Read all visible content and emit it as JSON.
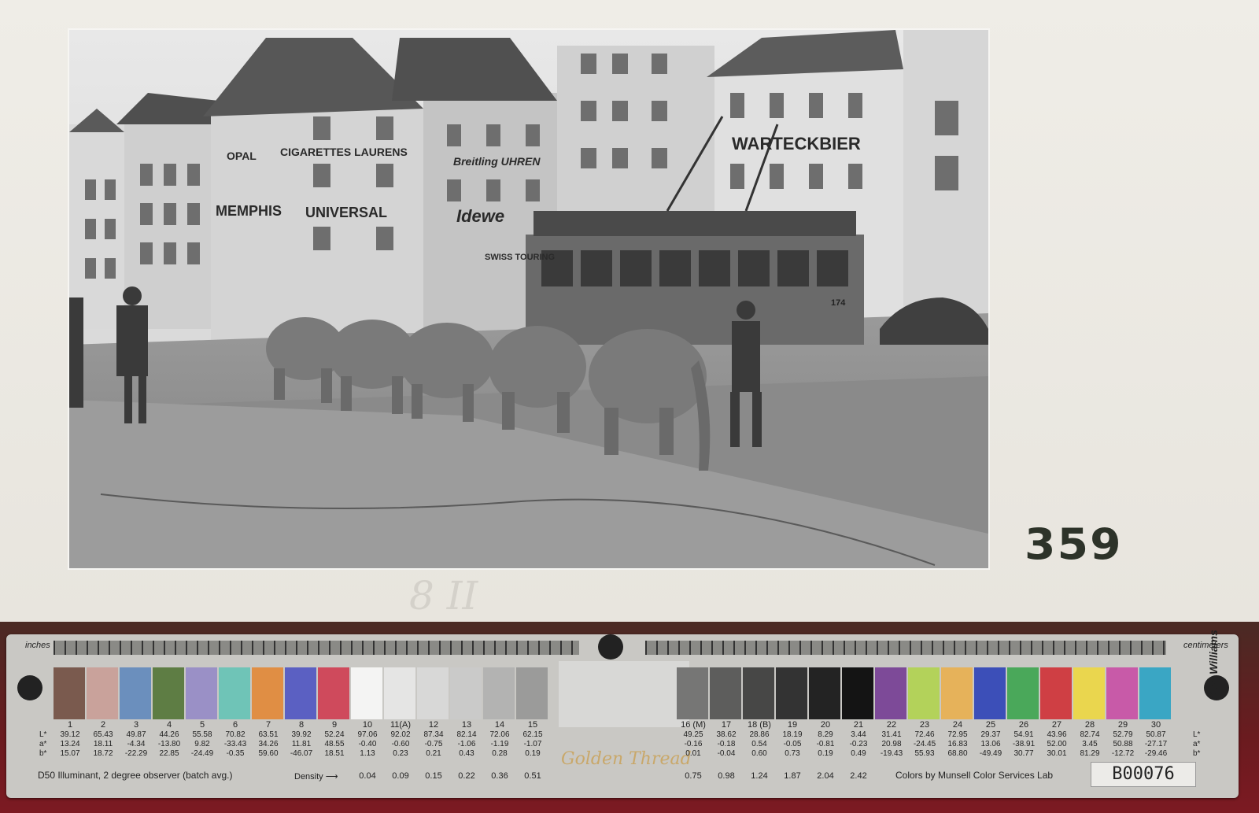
{
  "photo": {
    "description_icon": "street-scene-photo"
  },
  "signs": {
    "laurens": "CIGARETTES LAURENS",
    "opal": "OPAL",
    "memphis": "MEMPHIS",
    "universal": "UNIVERSAL",
    "breitling": "Breitling UHREN",
    "idewe": "Idewe",
    "swiss_touring": "SWISS TOURING",
    "warteckbier": "WARTECKBIER",
    "tram_number": "174"
  },
  "mount": {
    "catalog_number": "359",
    "pencil_note": "8 II"
  },
  "target": {
    "inches_label": "inches",
    "cm_label": "centimeters",
    "illuminant": "D50 Illuminant, 2 degree observer (batch avg.)",
    "density_label": "Density",
    "brand": "Golden Thread",
    "munsell": "Colors by Munsell Color Services Lab",
    "batch_id": "B00076",
    "signature": "Don Williams",
    "patches_left": [
      {
        "n": "1",
        "c": "#7a5a4e",
        "L": "39.12",
        "a": "13.24",
        "b": "15.07",
        "d": ""
      },
      {
        "n": "2",
        "c": "#c9a29b",
        "L": "65.43",
        "a": "18.11",
        "b": "18.72",
        "d": ""
      },
      {
        "n": "3",
        "c": "#6b8fbd",
        "L": "49.87",
        "a": "-4.34",
        "b": "-22.29",
        "d": ""
      },
      {
        "n": "4",
        "c": "#5e7d44",
        "L": "44.26",
        "a": "-13.80",
        "b": "22.85",
        "d": ""
      },
      {
        "n": "5",
        "c": "#9a90c6",
        "L": "55.58",
        "a": "9.82",
        "b": "-24.49",
        "d": ""
      },
      {
        "n": "6",
        "c": "#6fc4b7",
        "L": "70.82",
        "a": "-33.43",
        "b": "-0.35",
        "d": ""
      },
      {
        "n": "7",
        "c": "#e08e44",
        "L": "63.51",
        "a": "34.26",
        "b": "59.60",
        "d": ""
      },
      {
        "n": "8",
        "c": "#5b60c2",
        "L": "39.92",
        "a": "11.81",
        "b": "-46.07",
        "d": ""
      },
      {
        "n": "9",
        "c": "#cf4a5c",
        "L": "52.24",
        "a": "48.55",
        "b": "18.51",
        "d": ""
      },
      {
        "n": "10",
        "c": "#f4f4f3",
        "L": "97.06",
        "a": "-0.40",
        "b": "1.13",
        "d": "0.04"
      },
      {
        "n": "11(A)",
        "c": "#e5e5e4",
        "L": "92.02",
        "a": "-0.60",
        "b": "0.23",
        "d": "0.09"
      },
      {
        "n": "12",
        "c": "#d8d8d7",
        "L": "87.34",
        "a": "-0.75",
        "b": "0.21",
        "d": "0.15"
      },
      {
        "n": "13",
        "c": "#cacac9",
        "L": "82.14",
        "a": "-1.06",
        "b": "0.43",
        "d": "0.22"
      },
      {
        "n": "14",
        "c": "#b3b3b2",
        "L": "72.06",
        "a": "-1.19",
        "b": "0.28",
        "d": "0.36"
      },
      {
        "n": "15",
        "c": "#9b9b9a",
        "L": "62.15",
        "a": "-1.07",
        "b": "0.19",
        "d": "0.51"
      }
    ],
    "patches_right": [
      {
        "n": "16 (M)",
        "c": "#767675",
        "L": "49.25",
        "a": "-0.16",
        "b": "0.01",
        "d": "0.75"
      },
      {
        "n": "17",
        "c": "#5d5d5c",
        "L": "38.62",
        "a": "-0.18",
        "b": "-0.04",
        "d": "0.98"
      },
      {
        "n": "18 (B)",
        "c": "#474746",
        "L": "28.86",
        "a": "0.54",
        "b": "0.60",
        "d": "1.24"
      },
      {
        "n": "19",
        "c": "#333333",
        "L": "18.19",
        "a": "-0.05",
        "b": "0.73",
        "d": "1.87"
      },
      {
        "n": "20",
        "c": "#232323",
        "L": "8.29",
        "a": "-0.81",
        "b": "0.19",
        "d": "2.04"
      },
      {
        "n": "21",
        "c": "#141414",
        "L": "3.44",
        "a": "-0.23",
        "b": "0.49",
        "d": "2.42"
      },
      {
        "n": "22",
        "c": "#7d4a98",
        "L": "31.41",
        "a": "20.98",
        "b": "-19.43",
        "d": ""
      },
      {
        "n": "23",
        "c": "#b3d25a",
        "L": "72.46",
        "a": "-24.45",
        "b": "55.93",
        "d": ""
      },
      {
        "n": "24",
        "c": "#e6b25a",
        "L": "72.95",
        "a": "16.83",
        "b": "68.80",
        "d": ""
      },
      {
        "n": "25",
        "c": "#3c4fb8",
        "L": "29.37",
        "a": "13.06",
        "b": "-49.49",
        "d": ""
      },
      {
        "n": "26",
        "c": "#4aa85a",
        "L": "54.91",
        "a": "-38.91",
        "b": "30.77",
        "d": ""
      },
      {
        "n": "27",
        "c": "#cf3f44",
        "L": "43.96",
        "a": "52.00",
        "b": "30.01",
        "d": ""
      },
      {
        "n": "28",
        "c": "#ead64e",
        "L": "82.74",
        "a": "3.45",
        "b": "81.29",
        "d": ""
      },
      {
        "n": "29",
        "c": "#c85aa8",
        "L": "52.79",
        "a": "50.88",
        "b": "-12.72",
        "d": ""
      },
      {
        "n": "30",
        "c": "#3aa6c4",
        "L": "50.87",
        "a": "-27.17",
        "b": "-29.46",
        "d": ""
      }
    ]
  }
}
